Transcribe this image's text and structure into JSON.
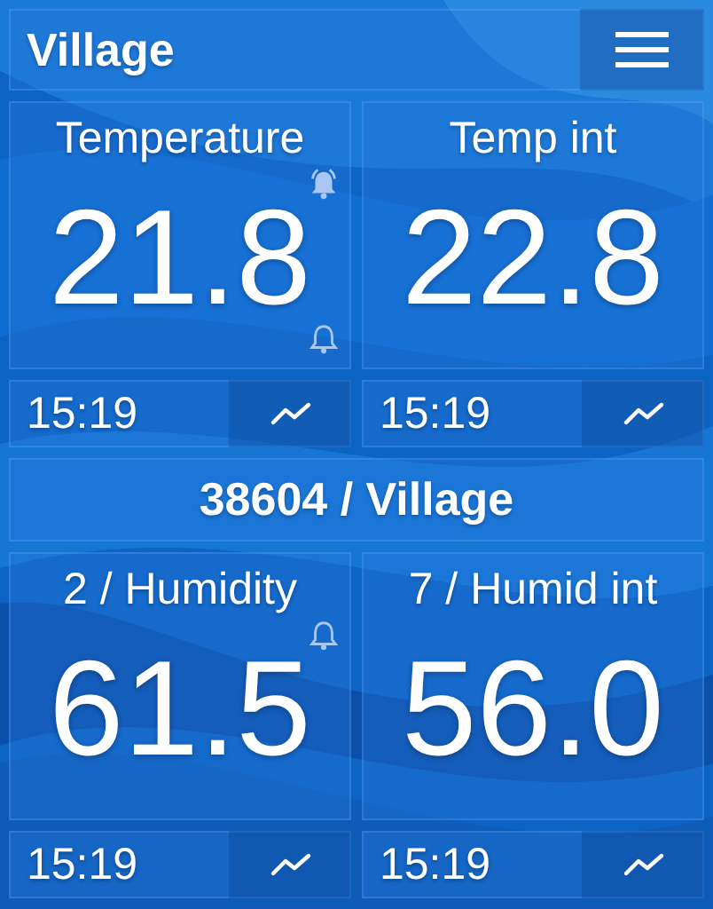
{
  "header": {
    "title": "Village"
  },
  "groups": [
    {
      "tiles": [
        {
          "label": "Temperature",
          "value": "21.8",
          "time": "15:19",
          "alarms": [
            {
              "kind": "high",
              "ringing": true
            },
            {
              "kind": "low",
              "ringing": false
            }
          ]
        },
        {
          "label": "Temp int",
          "value": "22.8",
          "time": "15:19"
        }
      ]
    },
    {
      "title": "38604 / Village",
      "tiles": [
        {
          "label": "2 / Humidity",
          "value": "61.5",
          "time": "15:19",
          "alarms": [
            {
              "kind": "high",
              "ringing": false
            }
          ]
        },
        {
          "label": "7 / Humid int",
          "value": "56.0",
          "time": "15:19"
        }
      ]
    }
  ]
}
